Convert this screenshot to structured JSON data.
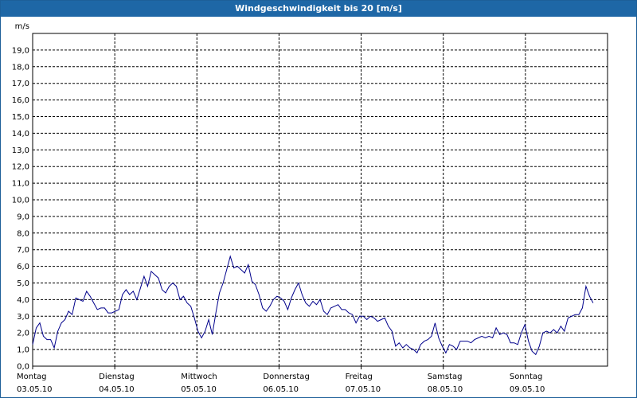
{
  "window": {
    "title": "Windgeschwindigkeit bis 20 [m/s]"
  },
  "colors": {
    "title_bar": "#1e67a6",
    "series": "#00008b",
    "grid": "#000000"
  },
  "chart_data": {
    "type": "line",
    "ylabel": "m/s",
    "ylim": [
      0,
      20
    ],
    "y_ticks": [
      "0,0",
      "1,0",
      "2,0",
      "3,0",
      "4,0",
      "5,0",
      "6,0",
      "7,0",
      "8,0",
      "9,0",
      "10,0",
      "11,0",
      "12,0",
      "13,0",
      "14,0",
      "15,0",
      "16,0",
      "17,0",
      "18,0",
      "19,0"
    ],
    "x_days": [
      {
        "day": "Montag",
        "date": "03.05.10"
      },
      {
        "day": "Dienstag",
        "date": "04.05.10"
      },
      {
        "day": "Mittwoch",
        "date": "05.05.10"
      },
      {
        "day": "Donnerstag",
        "date": "06.05.10"
      },
      {
        "day": "Freitag",
        "date": "07.05.10"
      },
      {
        "day": "Samstag",
        "date": "08.05.10"
      },
      {
        "day": "Sonntag",
        "date": "09.05.10"
      }
    ],
    "xlim_days": [
      0,
      7
    ],
    "grid": true,
    "grid_style": "dashed",
    "series": [
      {
        "color": "#00008b",
        "values": [
          1.3,
          2.3,
          2.6,
          1.8,
          1.6,
          1.6,
          1.1,
          2.1,
          2.6,
          2.8,
          3.3,
          3.1,
          4.1,
          4.0,
          3.9,
          4.5,
          4.2,
          3.8,
          3.4,
          3.5,
          3.5,
          3.2,
          3.2,
          3.3,
          3.4,
          4.3,
          4.6,
          4.3,
          4.5,
          4.0,
          4.7,
          5.4,
          4.8,
          5.7,
          5.5,
          5.3,
          4.6,
          4.4,
          4.8,
          5.0,
          4.8,
          4.0,
          4.2,
          3.8,
          3.6,
          2.9,
          2.1,
          1.7,
          2.1,
          2.8,
          1.9,
          3.2,
          4.4,
          5.0,
          5.8,
          6.6,
          5.9,
          6.0,
          5.8,
          5.6,
          6.1,
          5.1,
          4.9,
          4.3,
          3.5,
          3.3,
          3.6,
          4.0,
          4.2,
          4.1,
          3.9,
          3.4,
          4.1,
          4.6,
          5.0,
          4.3,
          3.8,
          3.6,
          3.9,
          3.7,
          4.0,
          3.3,
          3.1,
          3.5,
          3.6,
          3.7,
          3.4,
          3.4,
          3.2,
          3.1,
          2.6,
          3.0,
          3.0,
          2.8,
          3.0,
          2.9,
          2.7,
          2.8,
          2.9,
          2.4,
          2.1,
          1.2,
          1.4,
          1.1,
          1.3,
          1.1,
          1.0,
          0.8,
          1.3,
          1.5,
          1.6,
          1.8,
          2.6,
          1.7,
          1.2,
          0.8,
          1.3,
          1.2,
          1.0,
          1.5,
          1.5,
          1.5,
          1.4,
          1.6,
          1.7,
          1.8,
          1.7,
          1.8,
          1.7,
          2.3,
          1.9,
          2.0,
          1.9,
          1.4,
          1.4,
          1.3,
          2.0,
          2.5,
          1.5,
          0.9,
          0.7,
          1.2,
          2.0,
          2.1,
          2.0,
          2.2,
          2.0,
          2.4,
          2.1,
          2.9,
          3.0,
          3.1,
          3.1,
          3.5,
          4.8,
          4.2,
          3.8
        ]
      }
    ]
  }
}
